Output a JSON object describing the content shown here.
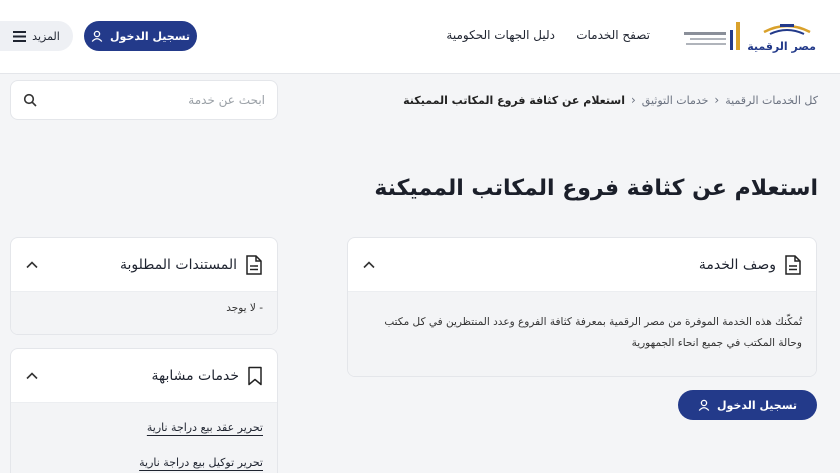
{
  "header": {
    "logo_text": "مصر الرقمية",
    "ministry_logo_text": "وزارة الاتصالات وتكنولوجيا المعلومات",
    "nav": {
      "browse_services": "تصفح الخدمات",
      "government_directory": "دليل الجهات الحكومية"
    },
    "login_label": "تسجيل الدخول",
    "more_label": "المزيد"
  },
  "breadcrumb": {
    "items": [
      "كل الخدمات الرقمية",
      "خدمات التوثيق"
    ],
    "current": "استعلام عن كثافة فروع المكاتب المميكنة"
  },
  "search": {
    "placeholder": "ابحث عن خدمة",
    "value": ""
  },
  "page": {
    "title": "استعلام عن كثافة فروع المكاتب المميكنة"
  },
  "service_description": {
    "title": "وصف الخدمة",
    "text": "تُمكّنك هذه الخدمة الموفرة من مصر الرقمية بمعرفة كثافة الفروع وعدد المنتظرين في كل مكتب وحالة المكتب في جميع انحاء الجمهورية"
  },
  "required_documents": {
    "title": "المستندات المطلوبة",
    "items": [
      "- لا يوجد"
    ]
  },
  "similar_services": {
    "title": "خدمات مشابهة",
    "items": [
      "تحرير عقد بيع دراجة نارية",
      "تحرير توكيل بيع دراجة نارية"
    ]
  },
  "login_bottom_label": "تسجيل الدخول",
  "colors": {
    "primary": "#233a8a",
    "background": "#f4f5f7",
    "card_body": "#f3f4f6"
  }
}
